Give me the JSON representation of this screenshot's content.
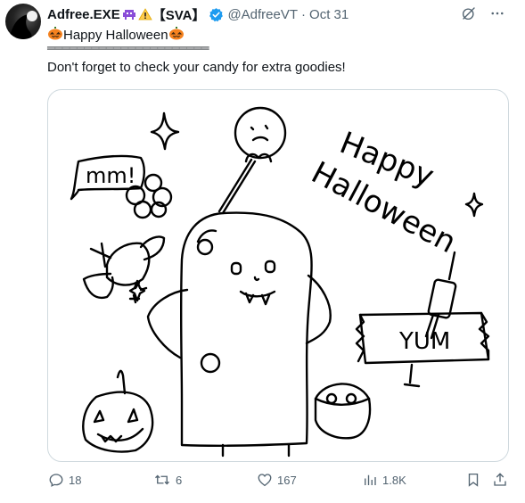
{
  "tweet": {
    "display_name": "Adfree.EXE",
    "name_suffix": "【SVA】",
    "handle": "@AdfreeVT",
    "separator": "·",
    "timestamp": "Oct 31",
    "text_line1": "Happy Halloween",
    "text_line2": "══════════════════════",
    "text_line3": "Don't forget to check your candy for extra goodies!"
  },
  "drawing": {
    "hap": "Happy",
    "halloween": "Halloween",
    "yum": "YUM",
    "mms": "mm!"
  },
  "actions": {
    "replies": "18",
    "reposts": "6",
    "likes": "167",
    "views": "1.8K"
  },
  "colors": {
    "text": "#0f1419",
    "secondary": "#536471",
    "verified": "#1d9bf0",
    "border": "#cfd9de",
    "pumpkin": "#f5821f"
  },
  "icons": [
    "avatar",
    "alien-monster-icon",
    "warning-icon",
    "verified-badge-icon",
    "grok-icon",
    "more-icon",
    "pumpkin-icon",
    "reply-icon",
    "repost-icon",
    "like-icon",
    "views-icon",
    "bookmark-icon",
    "share-icon"
  ]
}
